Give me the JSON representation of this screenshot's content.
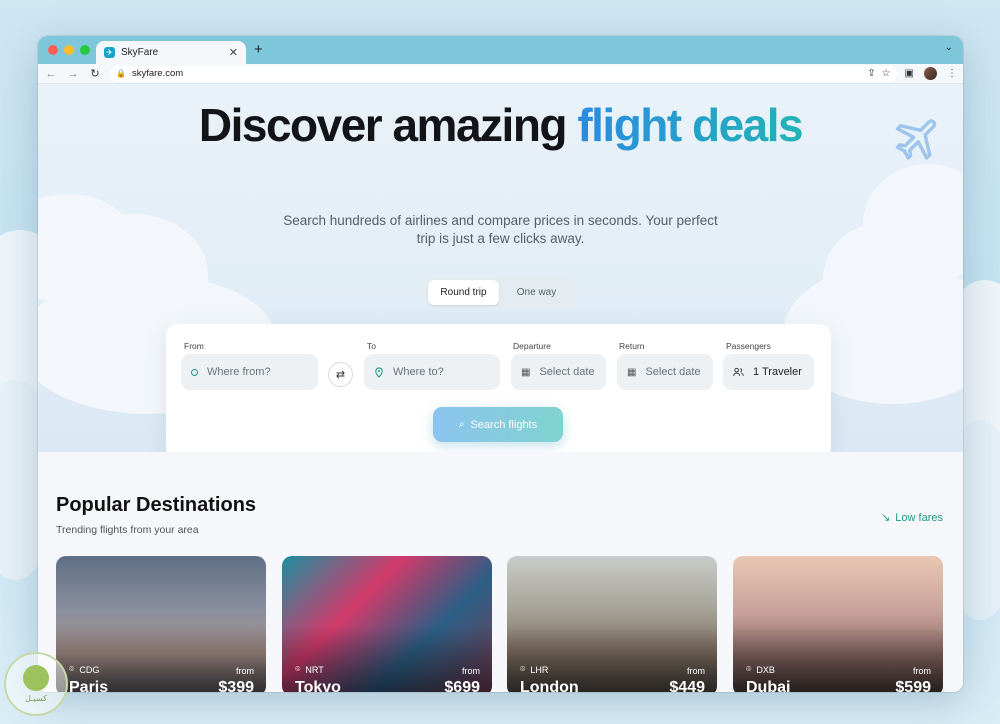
{
  "browser": {
    "tab_title": "SkyFare",
    "new_tab_label": "+",
    "url": "skyfare.com"
  },
  "hero": {
    "headline_part1": "Discover amazing",
    "headline_part2": "flight deals",
    "subheadline": "Search hundreds of airlines and compare prices in seconds. Your perfect trip is just a few clicks away.",
    "trip_types": [
      "Round trip",
      "One way"
    ],
    "selected_trip_type": "Round trip"
  },
  "search": {
    "from_label": "From",
    "from_placeholder": "Where from?",
    "to_label": "To",
    "to_placeholder": "Where to?",
    "departure_label": "Departure",
    "departure_value": "Select date",
    "return_label": "Return",
    "return_value": "Select date",
    "passengers_label": "Passengers",
    "passengers_value": "1 Traveler",
    "search_button": "Search flights"
  },
  "popular": {
    "title": "Popular Destinations",
    "subtitle": "Trending flights from your area",
    "low_fares_link": "Low fares",
    "from_label": "from",
    "destinations": [
      {
        "code": "CDG",
        "city": "Paris",
        "price": "$399"
      },
      {
        "code": "NRT",
        "city": "Tokyo",
        "price": "$699"
      },
      {
        "code": "LHR",
        "city": "London",
        "price": "$449"
      },
      {
        "code": "DXB",
        "city": "Dubai",
        "price": "$599"
      }
    ]
  },
  "watermark": {
    "text": "كسيـل"
  },
  "colors": {
    "accent_teal": "#1d9a86",
    "accent_blue": "#2a8be0",
    "tab_bar": "#7ec6d9"
  }
}
